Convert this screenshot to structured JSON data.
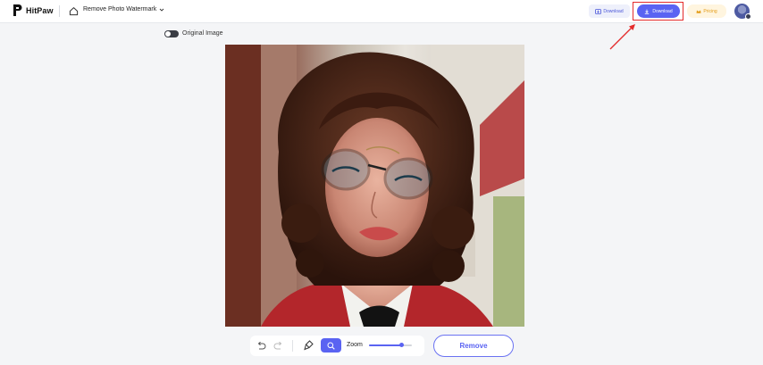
{
  "header": {
    "brand": "HitPaw",
    "tool_label": "Remove Photo Watermark",
    "download_secondary": "Download",
    "download_primary": "Download",
    "pricing": "Pricing"
  },
  "toggle": {
    "label": "Original Image",
    "on": true
  },
  "toolbar": {
    "zoom_label": "Zoom",
    "zoom_level": 0.75,
    "remove_label": "Remove"
  },
  "icons": {
    "home": "home-icon",
    "chevron": "chevron-down-icon",
    "download": "download-icon",
    "pricing": "crown-icon",
    "undo": "undo-icon",
    "redo": "redo-icon",
    "brush": "brush-icon",
    "zoom": "magnifier-icon"
  },
  "colors": {
    "accent": "#5a63f2",
    "annotation": "#e42b2b",
    "pricing": "#e39b16"
  }
}
